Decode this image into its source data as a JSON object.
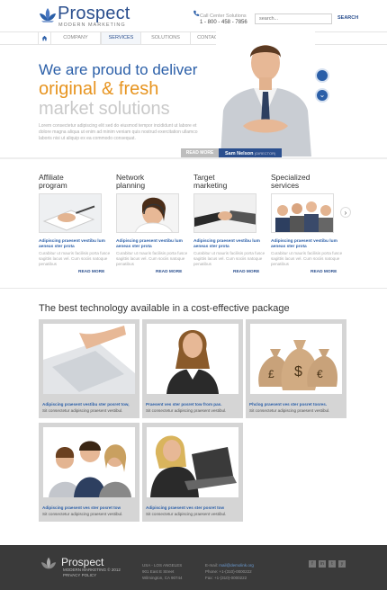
{
  "header": {
    "logo_title": "Prospect",
    "logo_sub": "MODERN MARKETING",
    "call_label": "Call Center Solutions",
    "phone": "1 - 800 - 458 - 7856",
    "search_placeholder": "search...",
    "search_button": "SEARCH"
  },
  "nav": {
    "items": [
      "COMPANY",
      "SERVICES",
      "SOLUTIONS",
      "CONTACTS"
    ]
  },
  "hero": {
    "line1": "We are proud to deliver",
    "line2": "original & fresh",
    "line3": "market solutions",
    "desc": "Lorem consectetur adipiscing elit sed do eiusmod tempor incididunt ut labore et dolore magna aliqua ut enim ad minim veniam quis nostrud exercitation ullamco laboris nisi ut aliquip ex ea commodo consequat.",
    "read_more": "READ MORE",
    "person_name": "Sam Nelson",
    "person_role": "(DIRECTOR)"
  },
  "services": [
    {
      "title": "Affiliate program",
      "link": "Adipiscing praesent vestibu lum aeneas ster prota",
      "text": "Curabitur ut mauris facilisis porta fusce sagittis lacus vel. Cum sociis natoque penatibus",
      "more": "READ MORE"
    },
    {
      "title": "Network planning",
      "link": "Adipiscing praesent vestibu lum aeneas ster prota",
      "text": "Curabitur ut mauris facilisis porta fusce sagittis lacus vel. Cum sociis natoque penatibus",
      "more": "READ MORE"
    },
    {
      "title": "Target marketing",
      "link": "Adipiscing praesent vestibu lum aeneas ster prota",
      "text": "Curabitur ut mauris facilisis porta fusce sagittis lacus vel. Cum sociis natoque penatibus",
      "more": "READ MORE"
    },
    {
      "title": "Specialized services",
      "link": "Adipiscing praesent vestibu lum aeneas ster prota",
      "text": "Curabitur ut mauris facilisis porta fusce sagittis lacus vel. Cum sociis natoque penatibus",
      "more": "READ MORE"
    }
  ],
  "grid": {
    "title": "The best technology available in a cost-effective package",
    "cards": [
      {
        "title": "Adipiscing praesent vestibu ster posret tow,",
        "sub": "Sit consectetur adipiscing praesent vestibul."
      },
      {
        "title": "Praesent ves ster posret tow from pas.",
        "sub": "Sit consectetur adipiscing praesent vestibul."
      },
      {
        "title": "Phclog praesent ves ster posret tosres.",
        "sub": "Sit consectetur adipiscing praesent vestibul."
      },
      {
        "title": "Adipiscing praesent ves ster posret tow",
        "sub": "Sit consectetur adipiscing praesent vestibul."
      },
      {
        "title": "Adipiscing praesent ves ster posret tow",
        "sub": "Sit consectetur adipiscing praesent vestibul."
      }
    ]
  },
  "footer": {
    "logo": "Prospect",
    "sub1": "MODERN MARKETING © 2012",
    "sub2": "PRIVACY POLICY",
    "addr1": "USA - LOS ANGELES",
    "addr2": "901 East E Street",
    "addr3": "Wilmington, CA 90744",
    "email_label": "E-mail:",
    "email": "mail@demolink.org",
    "phone": "Phone: +1-(310)-0000222",
    "fax": "Fax: +1-(310)-0000222",
    "social": [
      "f",
      "in",
      "t",
      "y"
    ]
  },
  "colors": {
    "accent": "#2b5fa8",
    "orange": "#e7941f",
    "dark": "#3a3a3a"
  }
}
